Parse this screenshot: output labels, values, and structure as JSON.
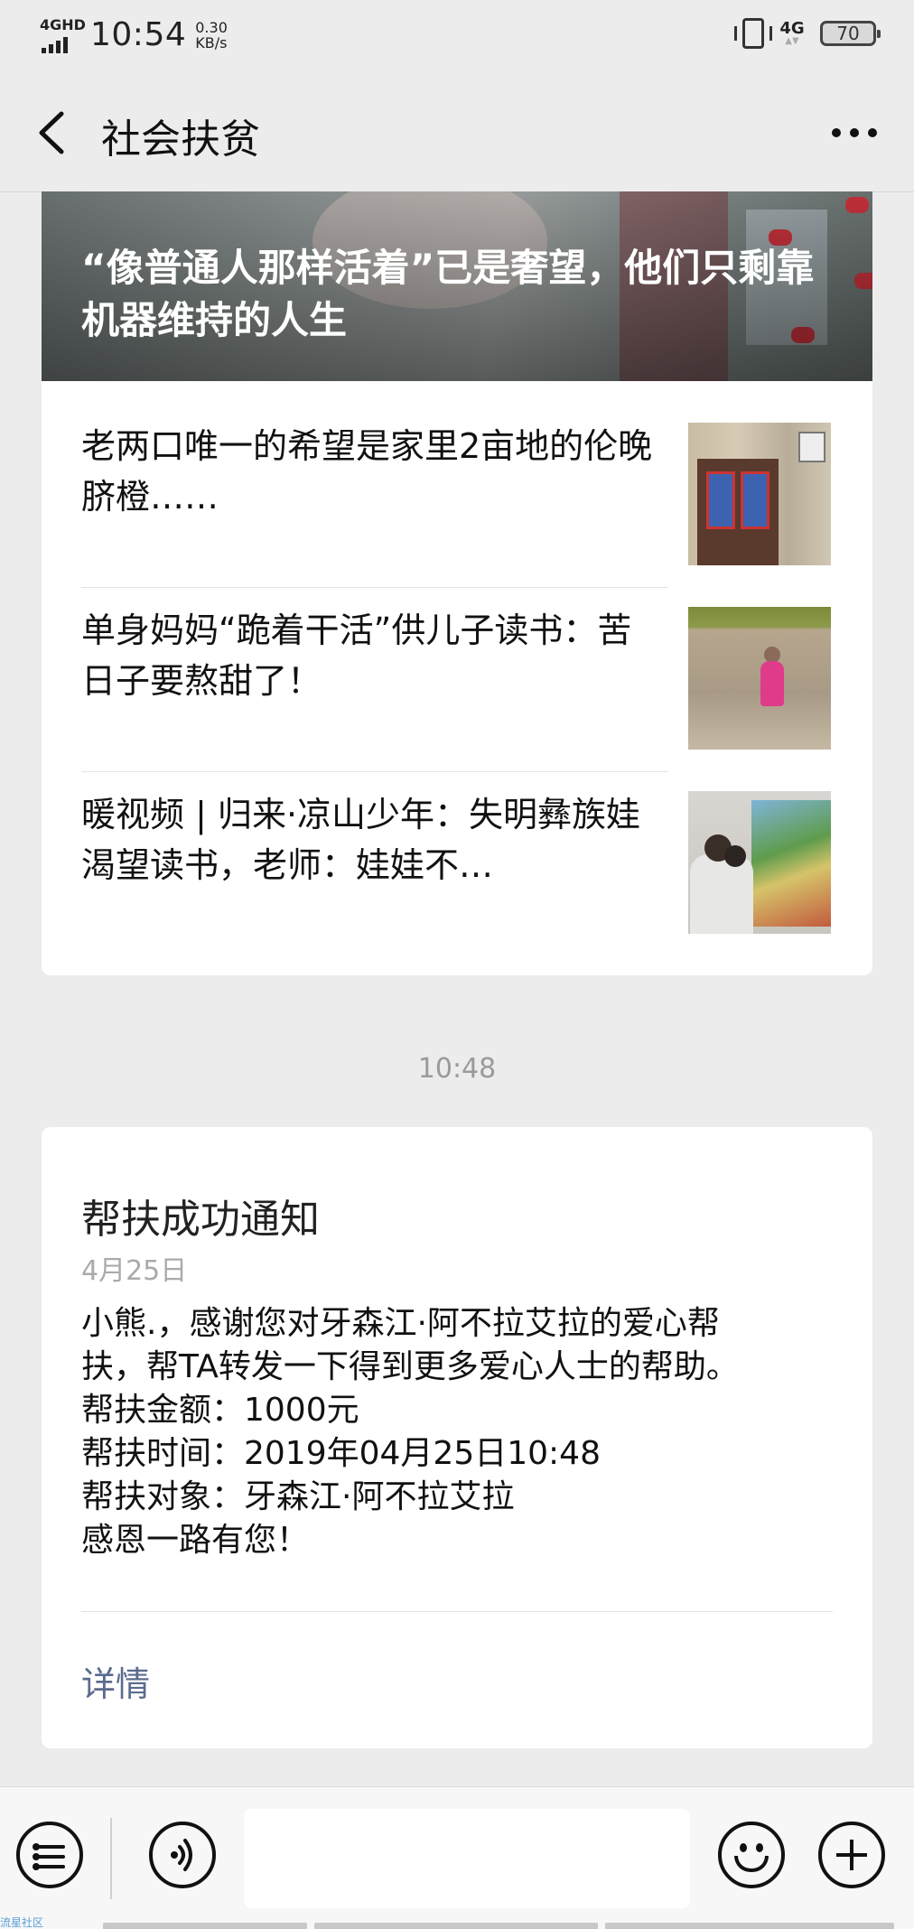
{
  "status_bar": {
    "network_label": "4GHD",
    "time": "10:54",
    "speed_value": "0.30",
    "speed_unit": "KB/s",
    "net_right": "4G",
    "battery": "70"
  },
  "nav": {
    "back_icon": "chevron-left-icon",
    "title": "社会扶贫",
    "more_icon": "ellipsis-icon"
  },
  "articles": {
    "hero_title": "“像普通人那样活着”已是奢望，他们只剩靠机器维持的人生",
    "items": [
      {
        "title": "老两口唯一的希望是家里2亩地的伦晚脐橙……"
      },
      {
        "title": "单身妈妈“跪着干活”供儿子读书：苦日子要熬甜了！"
      },
      {
        "title": "暖视频 | 归来·凉山少年：失明彝族娃渴望读书，老师：娃娃不…"
      }
    ]
  },
  "time_divider": "10:48",
  "notice": {
    "title": "帮扶成功通知",
    "date": "4月25日",
    "body": [
      "小熊.，感谢您对牙森江·阿不拉艾拉的爱心帮",
      "扶，帮TA转发一下得到更多爱心人士的帮助。",
      "帮扶金额：1000元",
      "帮扶时间：2019年04月25日10:48",
      "帮扶对象：牙森江·阿不拉艾拉",
      "感恩一路有您！"
    ],
    "link": "详情"
  },
  "toolbar": {
    "menu_icon": "list-menu-icon",
    "voice_icon": "voice-icon",
    "emoji_icon": "emoji-icon",
    "plus_icon": "plus-icon",
    "input_value": ""
  },
  "watermark": "流星社区"
}
